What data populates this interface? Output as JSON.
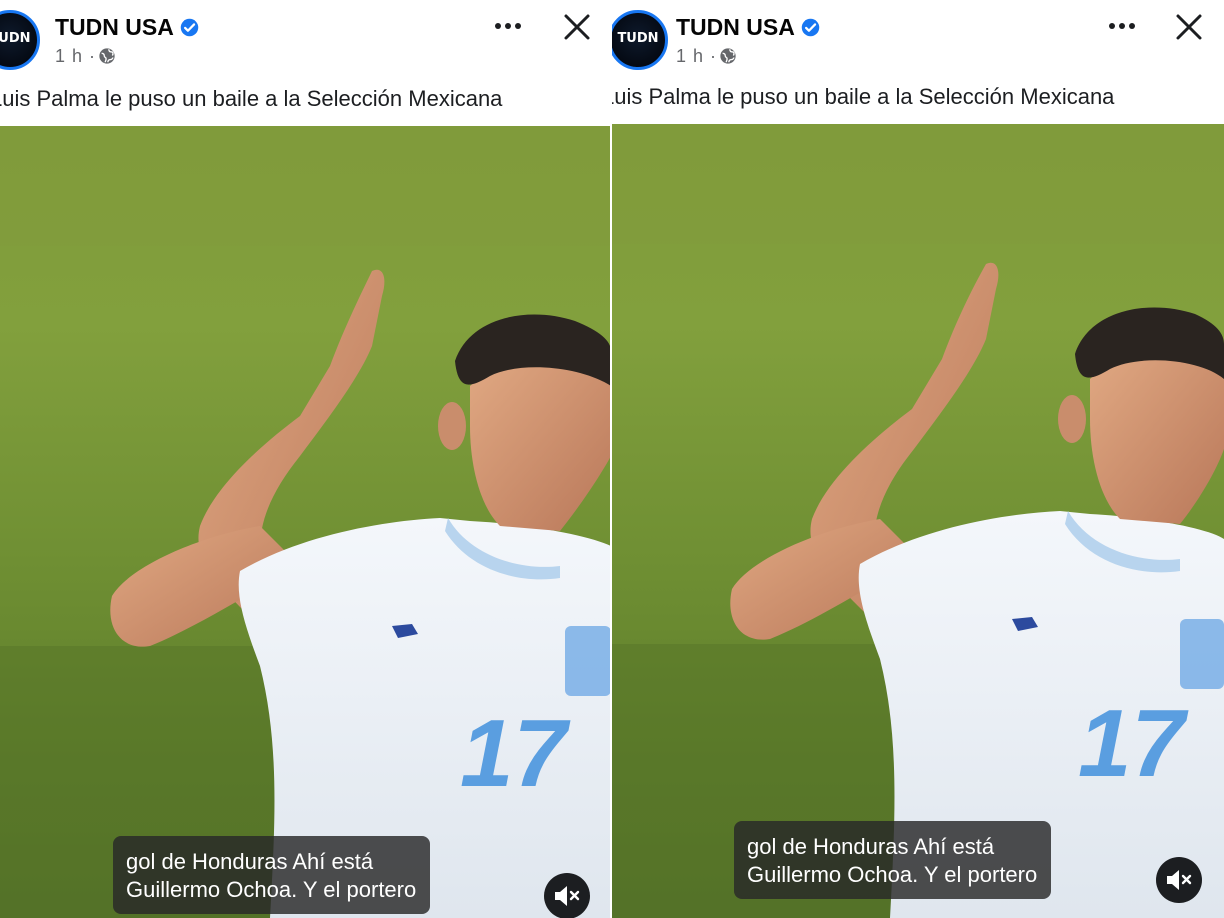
{
  "panels": [
    {
      "page_name": "TUDN USA",
      "avatar_text": "TUDN",
      "timestamp": "1 h",
      "meta_separator": "·",
      "post_text": "Luis Palma le puso un baile a la Selección Mexicana",
      "subtitles": [
        "gol de Honduras Ahí está",
        "Guillermo Ochoa. Y el portero"
      ],
      "jersey_number": "17"
    },
    {
      "page_name": "TUDN USA",
      "avatar_text": "TUDN",
      "timestamp": "1 h",
      "meta_separator": "·",
      "post_text": "Luis Palma le puso un baile a la Selección Mexicana",
      "subtitles": [
        "gol de Honduras Ahí está",
        "Guillermo Ochoa. Y el portero"
      ],
      "jersey_number": "17"
    }
  ],
  "icons": {
    "verified": "verified-badge-icon",
    "audience": "globe-icon",
    "more": "more-options-icon",
    "close": "close-icon",
    "mute": "muted-speaker-icon"
  },
  "colors": {
    "verified_blue": "#1877f2",
    "meta_gray": "#65676b",
    "jersey_number_blue": "#5a9ee0"
  }
}
